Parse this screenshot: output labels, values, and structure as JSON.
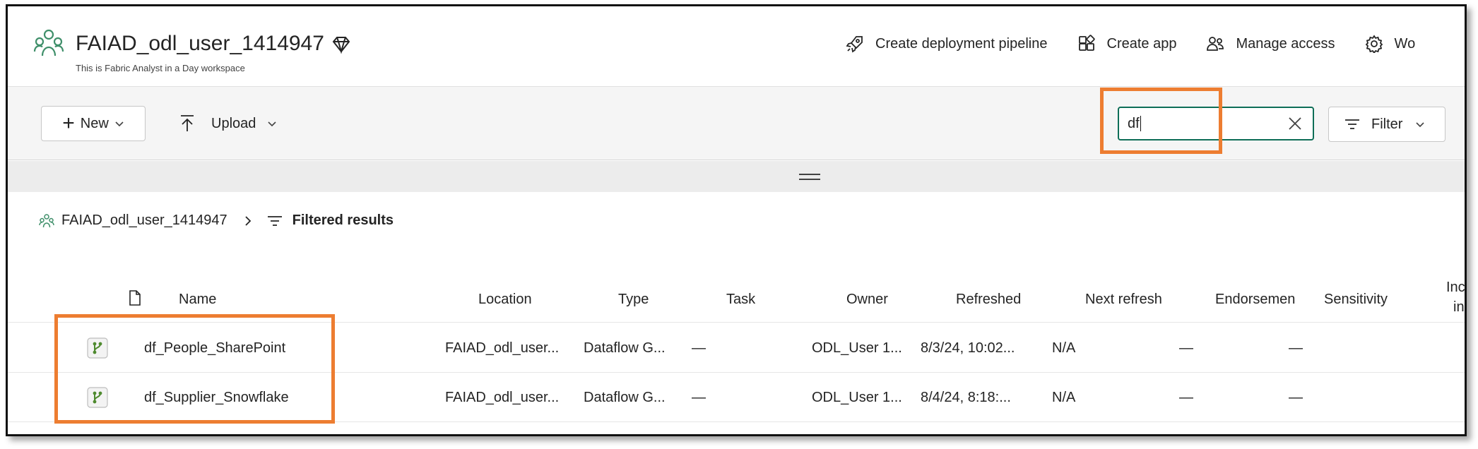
{
  "workspace": {
    "title": "FAIAD_odl_user_1414947",
    "subtitle": "This is Fabric Analyst in a Day workspace",
    "icon": "workspace-people-icon",
    "badge_icon": "premium-diamond-icon"
  },
  "header_actions": [
    {
      "label": "Create deployment pipeline",
      "icon": "rocket-icon"
    },
    {
      "label": "Create app",
      "icon": "app-icon"
    },
    {
      "label": "Manage access",
      "icon": "people-icon"
    },
    {
      "label": "Wo",
      "icon": "gear-icon"
    }
  ],
  "toolbar": {
    "new_label": "New",
    "upload_label": "Upload",
    "search_value": "df",
    "filter_label": "Filter"
  },
  "breadcrumb": {
    "workspace": "FAIAD_odl_user_1414947",
    "current": "Filtered results"
  },
  "table": {
    "columns": {
      "name": "Name",
      "location": "Location",
      "type": "Type",
      "task": "Task",
      "owner": "Owner",
      "refreshed": "Refreshed",
      "next_refresh": "Next refresh",
      "endorsement": "Endorsemen",
      "sensitivity": "Sensitivity",
      "included_1": "Inc",
      "included_2": "in"
    },
    "rows": [
      {
        "name": "df_People_SharePoint",
        "location": "FAIAD_odl_user...",
        "type": "Dataflow G...",
        "task": "—",
        "owner": "ODL_User 1...",
        "refreshed": "8/3/24, 10:02...",
        "next_refresh": "N/A",
        "endorsement": "—",
        "sensitivity": "—"
      },
      {
        "name": "df_Supplier_Snowflake",
        "location": "FAIAD_odl_user...",
        "type": "Dataflow G...",
        "task": "—",
        "owner": "ODL_User 1...",
        "refreshed": "8/4/24, 8:18:...",
        "next_refresh": "N/A",
        "endorsement": "—",
        "sensitivity": "—"
      }
    ]
  },
  "colors": {
    "accent": "#0e6e57",
    "highlight": "#ed7d31",
    "dataflow_icon": "#4e8a2e"
  }
}
